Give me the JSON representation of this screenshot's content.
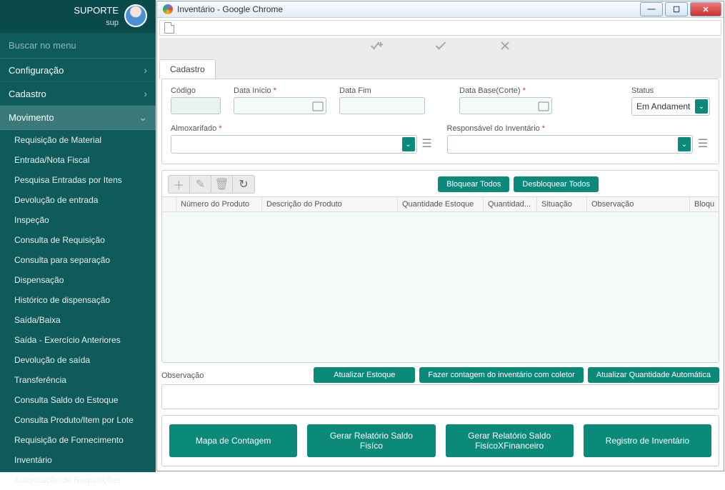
{
  "sidebar": {
    "user_title": "SUPORTE",
    "user_sub": "sup",
    "search_placeholder": "Buscar no menu",
    "sections": {
      "config": "Configuração",
      "cadastro": "Cadastro",
      "movimento": "Movimento"
    },
    "items": [
      "Requisição de Material",
      "Entrada/Nota Fiscal",
      "Pesquisa Entradas por Itens",
      "Devolução de entrada",
      "Inspeção",
      "Consulta de Requisição",
      "Consulta para separação",
      "Dispensação",
      "Histórico de dispensação",
      "Saída/Baixa",
      "Saída - Exercício Anteriores",
      "Devolução de saída",
      "Transferência",
      "Consulta Saldo do Estoque",
      "Consulta Produto/Item por Lote",
      "Requisição de Fornecimento",
      "Inventário",
      "Autorização de Requisições"
    ]
  },
  "window": {
    "title": "Inventário - Google Chrome"
  },
  "tabs": {
    "active": "Cadastro"
  },
  "form": {
    "codigo_label": "Código",
    "data_inicio_label": "Data Início",
    "data_fim_label": "Data Fim",
    "data_base_label": "Data Base(Corte)",
    "status_label": "Status",
    "status_value": "Em Andament",
    "almox_label": "Almoxarifado",
    "resp_label": "Responsável do Inventário"
  },
  "grid": {
    "block_all": "Bloquear Todos",
    "unblock_all": "Desbloquear Todos",
    "cols": {
      "num": "Número do Produto",
      "desc": "Descrição do Produto",
      "qest": "Quantidade Estoque",
      "qtd": "Quantidad...",
      "sit": "Situação",
      "obs": "Observação",
      "bloq": "Bloqu"
    }
  },
  "obs": {
    "label": "Observação",
    "btn_atualizar": "Atualizar Estoque",
    "btn_contagem": "Fazer contagem do inventário com coletor",
    "btn_auto": "Atualizar Quantidade Automática"
  },
  "bottom": {
    "mapa": "Mapa de Contagem",
    "relfis": "Gerar Relatório Saldo Fisíco",
    "relfin": "Gerar Relatório Saldo FisícoXFinanceiro",
    "reg": "Registro de Inventário"
  }
}
